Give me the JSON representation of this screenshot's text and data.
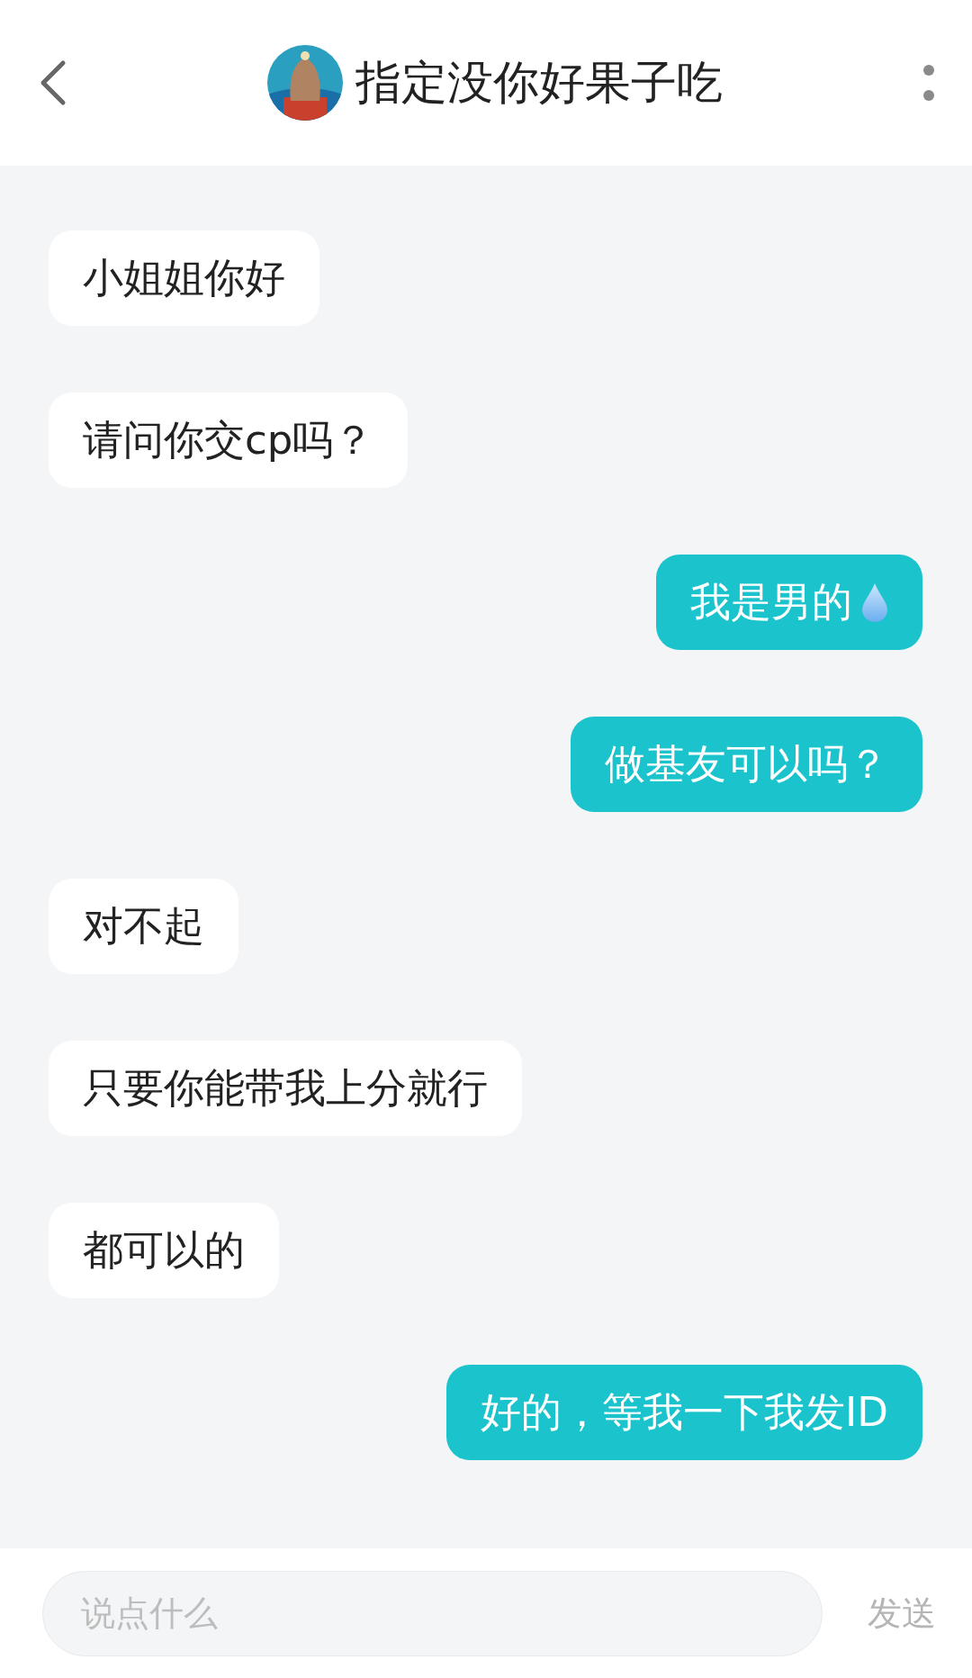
{
  "header": {
    "title": "指定没你好果子吃"
  },
  "messages": [
    {
      "kind": "received",
      "text": "小姐姐你好"
    },
    {
      "kind": "received",
      "text": "请问你交cp吗？"
    },
    {
      "kind": "sent",
      "text": "我是男的",
      "drop_icon": true
    },
    {
      "kind": "sent",
      "text": "做基友可以吗？"
    },
    {
      "kind": "received",
      "text": "对不起"
    },
    {
      "kind": "received",
      "text": "只要你能带我上分就行"
    },
    {
      "kind": "received",
      "text": "都可以的"
    },
    {
      "kind": "sent",
      "text": "好的，等我一下我发ID"
    }
  ],
  "composer": {
    "placeholder": "说点什么",
    "send_label": "发送"
  }
}
